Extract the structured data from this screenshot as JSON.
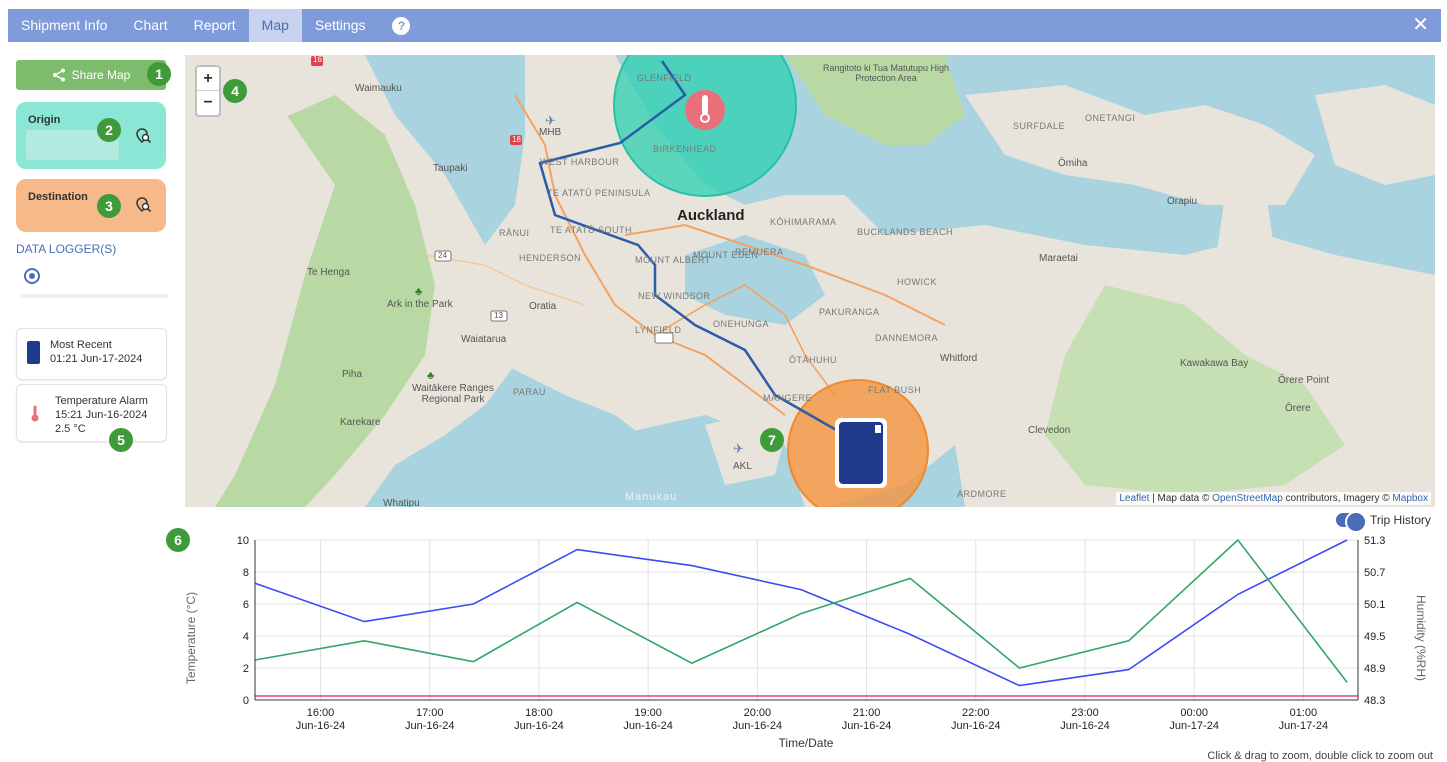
{
  "nav": {
    "tabs": [
      {
        "label": "Shipment Info",
        "active": false
      },
      {
        "label": "Chart",
        "active": false
      },
      {
        "label": "Report",
        "active": false
      },
      {
        "label": "Map",
        "active": true
      },
      {
        "label": "Settings",
        "active": false
      }
    ],
    "help_label": "?",
    "close_label": "✕"
  },
  "sidebar": {
    "share_label": "Share Map",
    "origin_label": "Origin",
    "destination_label": "Destination",
    "data_logger_title": "DATA LOGGER(S)",
    "events": [
      {
        "title": "Most Recent",
        "time": "01:21 Jun-17-2024"
      },
      {
        "title": "Temperature Alarm",
        "time": "15:21 Jun-16-2024",
        "value": "2.5 °C"
      }
    ]
  },
  "badges": [
    "1",
    "2",
    "3",
    "4",
    "5",
    "6",
    "7"
  ],
  "map": {
    "zoom_in": "+",
    "zoom_out": "−",
    "labels": {
      "auckland": "Auckland",
      "waimauku": "Waimauku",
      "taupaki": "Taupaki",
      "west_harbour": "WEST HARBOUR",
      "te_atatu": "TE ATATŪ PENINSULA",
      "te_atatu_south": "TE ATATŪ SOUTH",
      "ranui": "RĀNUI",
      "henderson": "HENDERSON",
      "mt_albert": "MOUNT ALBERT",
      "mt_eden": "MOUNT EDEN",
      "remuera": "REMUERA",
      "new_windsor": "NEW WINDSOR",
      "lynfield": "LYNFIELD",
      "onehunga": "ONEHUNGA",
      "pakuranga": "PAKURANGA",
      "howick": "HOWICK",
      "dannemora": "DANNEMORA",
      "otahuhu": "ŌTĀHUHU",
      "mangere": "MĀNGERE",
      "flat_bush": "FLAT BUSH",
      "ardmore": "ARDMORE",
      "te_henga": "Te Henga",
      "ark_park": "Ark in the Park",
      "oratia": "Oratia",
      "waiatarua": "Waiatarua",
      "piha": "Piha",
      "waitakere": "Waitākere Ranges Regional Park",
      "paraj": "PARAU",
      "karekare": "Karekare",
      "whatipu": "Whatipu",
      "manukau": "Manukau",
      "akl": "AKL",
      "mhb": "MHB",
      "glenfield": "GLENFIELD",
      "birkenhead": "BIRKENHEAD",
      "kohimarama": "KŌHIMARAMA",
      "bucklands": "BUCKLANDS BEACH",
      "whitford": "Whitford",
      "maraetai": "Maraetai",
      "kawakawa": "Kawakawa Bay",
      "orere_point": "Ōrere Point",
      "orere": "Ōrere",
      "clevedon": "Clevedon",
      "omiha": "Ōmiha",
      "onetangi": "ONETANGI",
      "surfdale": "SURFDALE",
      "orapiu": "Orapiu",
      "rangitoto": "Rangitoto ki Tua Matutupu High Protection Area",
      "road_16": "16",
      "road_18": "18",
      "road_24": "24",
      "road_13": "13"
    },
    "attribution": {
      "leaflet": "Leaflet",
      "text": " | Map data © ",
      "osm": "OpenStreetMap",
      "text2": " contributors, Imagery © ",
      "mapbox": "Mapbox"
    },
    "colors": {
      "origin_circle": "#2ed1b0",
      "destination_circle": "#f5933e",
      "route": "#2b5da6"
    }
  },
  "trip_history_label": "Trip History",
  "zoom_hint": "Click & drag to zoom, double click to zoom out",
  "chart_data": {
    "type": "line",
    "xlabel": "Time/Date",
    "ylabel": "Temperature (°C)",
    "y2label": "Humidity (%RH)",
    "ylim": [
      0,
      10
    ],
    "y2lim": [
      48.3,
      51.3
    ],
    "yticks": [
      "0",
      "2",
      "4",
      "6",
      "8",
      "10"
    ],
    "y2ticks": [
      "48.3",
      "48.9",
      "49.5",
      "50.1",
      "50.7",
      "51.3"
    ],
    "xticks": [
      {
        "time": "16:00",
        "date": "Jun-16-24"
      },
      {
        "time": "17:00",
        "date": "Jun-16-24"
      },
      {
        "time": "18:00",
        "date": "Jun-16-24"
      },
      {
        "time": "19:00",
        "date": "Jun-16-24"
      },
      {
        "time": "20:00",
        "date": "Jun-16-24"
      },
      {
        "time": "21:00",
        "date": "Jun-16-24"
      },
      {
        "time": "22:00",
        "date": "Jun-16-24"
      },
      {
        "time": "23:00",
        "date": "Jun-16-24"
      },
      {
        "time": "00:00",
        "date": "Jun-17-24"
      },
      {
        "time": "01:00",
        "date": "Jun-17-24"
      }
    ],
    "x_range_hours": [
      15.4,
      25.5
    ],
    "series": [
      {
        "axis": "left",
        "color": "#3b4cf0",
        "x": [
          15.4,
          16.4,
          17.4,
          18.35,
          19.4,
          20.4,
          21.4,
          22.4,
          23.4,
          24.4,
          25.4
        ],
        "y": [
          7.3,
          4.9,
          6.0,
          9.4,
          8.4,
          6.9,
          4.1,
          0.9,
          1.9,
          6.6,
          10.0
        ]
      },
      {
        "axis": "left",
        "color": "#2fa766",
        "x": [
          15.4,
          16.4,
          17.4,
          18.35,
          19.4,
          20.4,
          21.4,
          22.4,
          23.4,
          24.4,
          25.4
        ],
        "y": [
          2.5,
          3.7,
          2.4,
          6.1,
          2.3,
          5.4,
          7.6,
          2.0,
          3.7,
          10.0,
          1.1
        ]
      },
      {
        "axis": "left",
        "color": "#e0457a",
        "x": [
          15.4,
          25.5
        ],
        "y": [
          0.25,
          0.25
        ]
      }
    ]
  }
}
